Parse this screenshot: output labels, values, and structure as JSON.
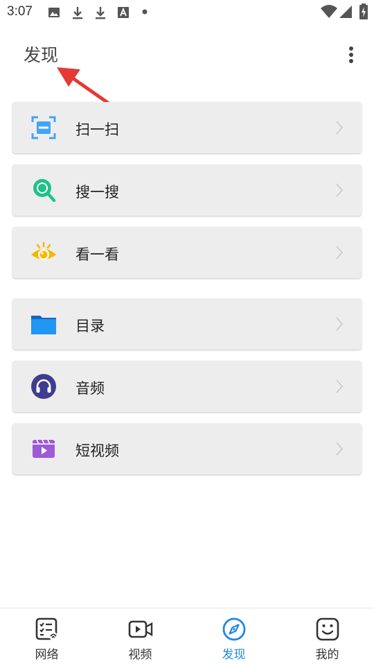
{
  "status_bar": {
    "time": "3:07",
    "icons": [
      "image-icon",
      "download-icon",
      "download-icon",
      "font-icon",
      "dot-icon",
      "wifi-icon",
      "signal-icon",
      "battery-charging-icon"
    ]
  },
  "header": {
    "title": "发现",
    "menu_icon": "more-vertical-icon"
  },
  "cards": [
    {
      "label": "扫一扫",
      "icon": "scan-icon",
      "color": "#42a5f5"
    },
    {
      "label": "搜一搜",
      "icon": "search-icon",
      "color": "#1ec28b"
    },
    {
      "label": "看一看",
      "icon": "eye-icon",
      "color": "#f5b800"
    },
    {
      "label": "目录",
      "icon": "folder-icon",
      "color": "#1e88e5"
    },
    {
      "label": "音频",
      "icon": "headphones-icon",
      "color": "#3f3d8f"
    },
    {
      "label": "短视频",
      "icon": "video-clip-icon",
      "color": "#9c5ad6"
    }
  ],
  "bottom_nav": {
    "items": [
      {
        "label": "网络",
        "icon": "network-list-icon",
        "active": false
      },
      {
        "label": "视频",
        "icon": "video-icon",
        "active": false
      },
      {
        "label": "发现",
        "icon": "compass-icon",
        "active": true
      },
      {
        "label": "我的",
        "icon": "smiley-icon",
        "active": false
      }
    ],
    "active_color": "#1e88e5"
  },
  "annotation": {
    "color": "#e53935"
  }
}
